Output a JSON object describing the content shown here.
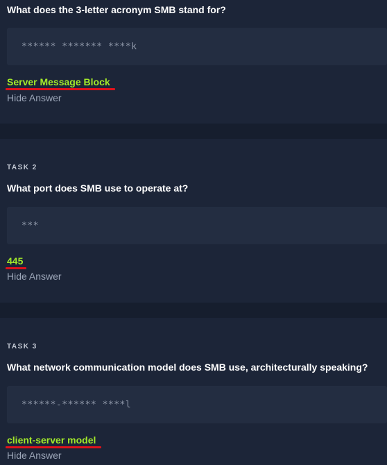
{
  "colors": {
    "background": "#1c2538",
    "separator": "#161e2e",
    "answer_box": "#232d41",
    "answer_text": "#a3ea2a",
    "annotation_underline": "#e0121b"
  },
  "tasks": [
    {
      "label": "",
      "question": "What does the 3-letter acronym SMB stand for?",
      "answer_mask": "****** ******* ****k",
      "revealed_answer": "Server Message Block",
      "hide_label": "Hide Answer"
    },
    {
      "label": "TASK 2",
      "question": "What port does SMB use to operate at?",
      "answer_mask": "***",
      "revealed_answer": "445",
      "hide_label": "Hide Answer"
    },
    {
      "label": "TASK 3",
      "question": "What network communication model does SMB use, architecturally speaking?",
      "answer_mask": "******-****** ****l",
      "revealed_answer": "client-server model",
      "hide_label": "Hide Answer"
    }
  ]
}
